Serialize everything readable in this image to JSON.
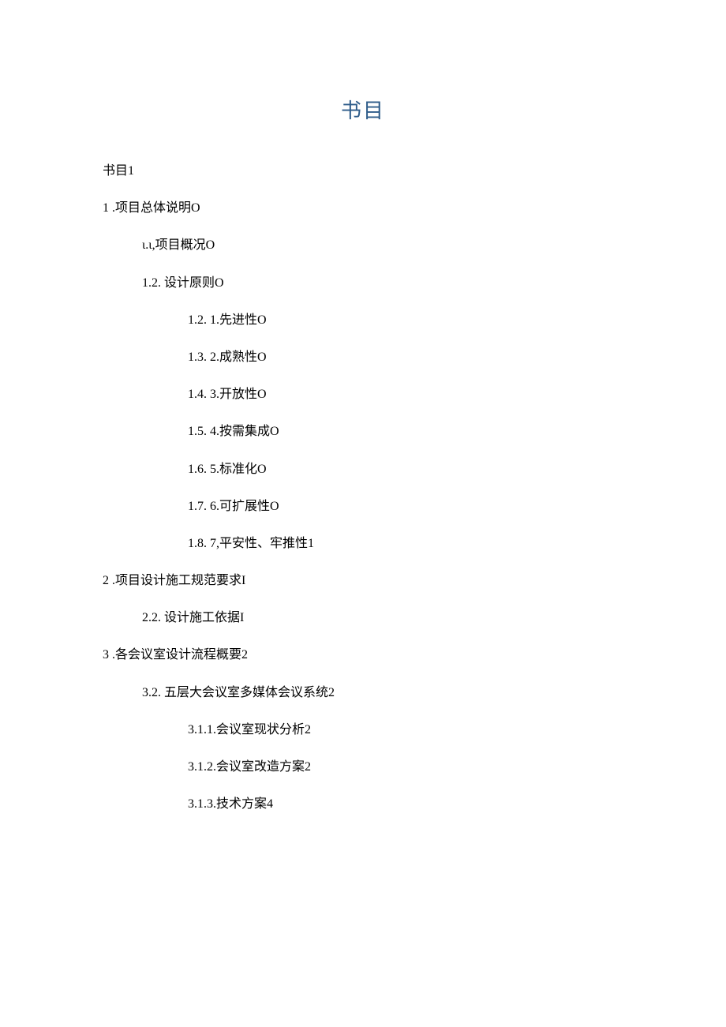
{
  "title": "书目",
  "entries": [
    {
      "level": 0,
      "text": "书目1"
    },
    {
      "level": 1,
      "text": "1 .项目总体说明O"
    },
    {
      "level": 2,
      "text": "ι.ι,项目概况O"
    },
    {
      "level": 2,
      "text": "1.2.   设计原则O"
    },
    {
      "level": 3,
      "text": "1.2.   1.先进性O"
    },
    {
      "level": 3,
      "text": "1.3.   2.成熟性O"
    },
    {
      "level": 3,
      "text": "1.4.   3.开放性O"
    },
    {
      "level": 3,
      "text": "1.5.   4.按需集成O"
    },
    {
      "level": 3,
      "text": "1.6.   5.标准化O"
    },
    {
      "level": 3,
      "text": "1.7.   6.可扩展性O"
    },
    {
      "level": 3,
      "text": "1.8.   7,平安性、牢推性1"
    },
    {
      "level": 1,
      "text": "2  .项目设计施工规范要求I"
    },
    {
      "level": 2,
      "text": "2.2.   设计施工依据I"
    },
    {
      "level": 1,
      "text": "3 .各会议室设计流程概要2"
    },
    {
      "level": 2,
      "text": "3.2.   五层大会议室多媒体会议系统2"
    },
    {
      "level": 3,
      "text": "3.1.1.会议室现状分析2"
    },
    {
      "level": 3,
      "text": "3.1.2.会议室改造方案2"
    },
    {
      "level": 3,
      "text": "3.1.3.技术方案4"
    }
  ]
}
